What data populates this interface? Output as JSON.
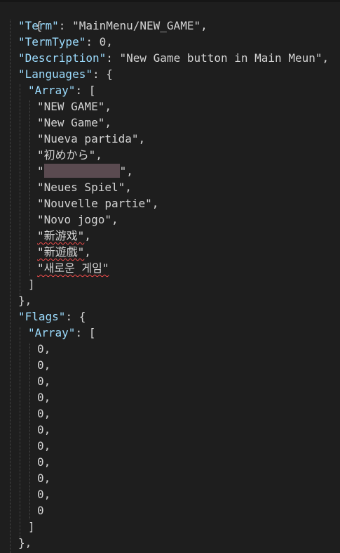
{
  "editor": {
    "line1_open": "{",
    "term_key": "\"Term\"",
    "term_value": "\"MainMenu/NEW_GAME\"",
    "termtype_key": "\"TermType\"",
    "termtype_value": "0",
    "description_key": "\"Description\"",
    "description_value": "\"New Game button in Main Meun\"",
    "languages_key": "\"Languages\"",
    "languages_array_key": "\"Array\"",
    "languages": [
      "\"NEW GAME\"",
      "\"New Game\"",
      "\"Nueva partida\"",
      "\"初めから\"",
      "\"\"",
      "\"Neues Spiel\"",
      "\"Nouvelle partie\"",
      "\"Novo jogo\"",
      "\"新游戏\"",
      "\"新遊戲\"",
      "\"새로운 게임\""
    ],
    "flags_key": "\"Flags\"",
    "flags_array_key": "\"Array\"",
    "flags": [
      "0",
      "0",
      "0",
      "0",
      "0",
      "0",
      "0",
      "0",
      "0",
      "0",
      "0"
    ]
  }
}
